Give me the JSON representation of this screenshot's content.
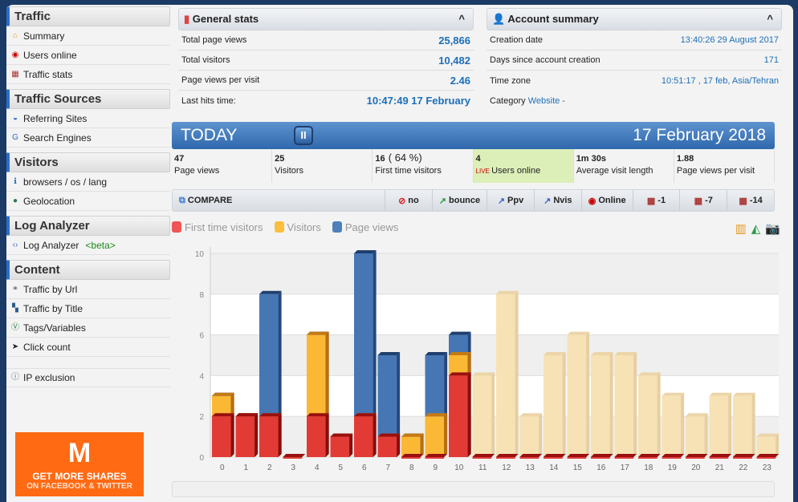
{
  "sidebar": {
    "sections": [
      {
        "title": "Traffic",
        "items": [
          {
            "label": "Summary",
            "icon": "home-icon"
          },
          {
            "label": "Users online",
            "icon": "live-icon"
          },
          {
            "label": "Traffic stats",
            "icon": "calendar-icon"
          }
        ]
      },
      {
        "title": "Traffic Sources",
        "items": [
          {
            "label": "Referring Sites",
            "icon": "referrer-icon"
          },
          {
            "label": "Search Engines",
            "icon": "google-icon"
          }
        ]
      },
      {
        "title": "Visitors",
        "items": [
          {
            "label": "browsers / os / lang",
            "icon": "info-icon"
          },
          {
            "label": "Geolocation",
            "icon": "globe-icon"
          }
        ]
      },
      {
        "title": "Log Analyzer",
        "items": [
          {
            "label": "Log Analyzer",
            "icon": "code-icon",
            "badge": "<beta>"
          }
        ]
      },
      {
        "title": "Content",
        "items": [
          {
            "label": "Traffic by Url",
            "icon": "link-icon"
          },
          {
            "label": "Traffic by Title",
            "icon": "title-icon"
          },
          {
            "label": "Tags/Variables",
            "icon": "tag-icon"
          },
          {
            "label": "Click count",
            "icon": "cursor-icon"
          }
        ]
      }
    ],
    "ip_exclusion": "IP exclusion",
    "ad": {
      "logo": "M",
      "line1": "GET MORE SHARES",
      "line2": "ON FACEBOOK & TWITTER"
    }
  },
  "general_stats": {
    "title": "General stats",
    "rows": [
      {
        "label": "Total page views",
        "value": "25,866"
      },
      {
        "label": "Total visitors",
        "value": "10,482"
      },
      {
        "label": "Page views per visit",
        "value": "2.46"
      },
      {
        "label": "Last hits time:",
        "value": "10:47:49 17 February"
      }
    ]
  },
  "account_summary": {
    "title": "Account summary",
    "rows": [
      {
        "label": "Creation date",
        "value": "13:40:26 29 August 2017"
      },
      {
        "label": "Days since account creation",
        "value": "171"
      },
      {
        "label": "Time zone",
        "value": "10:51:17 , 17 feb, Asia/Tehran"
      }
    ],
    "category_label": "Category",
    "category_value": "Website -"
  },
  "today": {
    "label": "TODAY",
    "date": "17 February 2018",
    "kpis": [
      {
        "value": "47",
        "label": "Page views"
      },
      {
        "value": "25",
        "label": "Visitors"
      },
      {
        "value": "16",
        "extra": "( 64 %)",
        "label": "First time visitors"
      },
      {
        "value": "4",
        "label": "Users online"
      },
      {
        "value": "1m 30s",
        "label": "Average visit length"
      },
      {
        "value": "1.88",
        "label": "Page views per visit"
      }
    ]
  },
  "compare": {
    "title": "COMPARE",
    "buttons": [
      {
        "label": "no",
        "icon": "no-icon"
      },
      {
        "label": "bounce",
        "icon": "bounce-icon"
      },
      {
        "label": "Ppv",
        "icon": "chart-icon"
      },
      {
        "label": "Nvis",
        "icon": "chart-icon"
      },
      {
        "label": "Online",
        "icon": "live-icon"
      },
      {
        "label": "-1",
        "icon": "calendar-icon"
      },
      {
        "label": "-7",
        "icon": "calendar-icon"
      },
      {
        "label": "-14",
        "icon": "calendar-icon"
      }
    ]
  },
  "colors": {
    "first_time": "#e8403e",
    "visitors": "#fbb731",
    "page_views": "#3e6ea8",
    "ghost": "#f5dfb0"
  },
  "chart_data": {
    "type": "bar",
    "ylim": [
      0,
      10
    ],
    "yticks": [
      0,
      2,
      4,
      6,
      8,
      10
    ],
    "categories": [
      "0",
      "1",
      "2",
      "3",
      "4",
      "5",
      "6",
      "7",
      "8",
      "9",
      "10",
      "11",
      "12",
      "13",
      "14",
      "15",
      "16",
      "17",
      "18",
      "19",
      "20",
      "21",
      "22",
      "23"
    ],
    "series": [
      {
        "name": "Page views",
        "values": [
          3,
          2,
          8,
          0,
          6,
          1,
          10,
          5,
          1,
          5,
          6,
          0,
          0,
          0,
          0,
          0,
          0,
          0,
          0,
          0,
          0,
          0,
          0,
          0
        ]
      },
      {
        "name": "Visitors",
        "values": [
          3,
          2,
          2,
          0,
          6,
          1,
          2,
          1,
          1,
          2,
          5,
          0,
          0,
          0,
          0,
          0,
          0,
          0,
          0,
          0,
          0,
          0,
          0,
          0
        ]
      },
      {
        "name": "First time visitors",
        "values": [
          2,
          2,
          2,
          0,
          2,
          1,
          2,
          1,
          0,
          0,
          4,
          0,
          0,
          0,
          0,
          0,
          0,
          0,
          0,
          0,
          0,
          0,
          0,
          0
        ]
      }
    ],
    "comparison_values": [
      null,
      null,
      null,
      null,
      null,
      null,
      null,
      null,
      null,
      null,
      null,
      4,
      8,
      2,
      5,
      6,
      5,
      5,
      4,
      3,
      2,
      3,
      3,
      1
    ]
  }
}
